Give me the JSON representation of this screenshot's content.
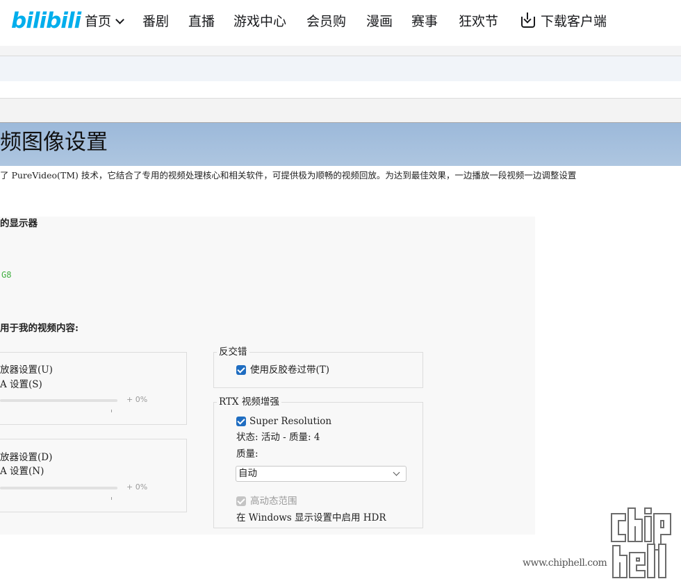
{
  "header": {
    "logo": "bilibili",
    "nav": [
      {
        "label": "首页"
      },
      {
        "label": "番剧"
      },
      {
        "label": "直播"
      },
      {
        "label": "游戏中心"
      },
      {
        "label": "会员购"
      },
      {
        "label": "漫画"
      },
      {
        "label": "赛事"
      },
      {
        "label": "狂欢节"
      },
      {
        "label": "下载客户端",
        "icon": "download-icon"
      }
    ]
  },
  "panel": {
    "title": "频图像设置",
    "description": "了 PureVideo(TM) 技术，它结合了专用的视频处理核心和相关软件，可提供极为顺畅的视频回放。为达到最佳效果，一边播放一段视频一边调整设置",
    "display_heading": "的显示器",
    "display_name": "G8",
    "content_heading": "用于我的视频内容:",
    "left_groups": [
      {
        "option1": "放器设置(U)",
        "option2": "A 设置(S)",
        "value": "+ 0%"
      },
      {
        "option1": "放器设置(D)",
        "option2": "A 设置(N)",
        "value": "+ 0%"
      }
    ],
    "deinterlace": {
      "title": "反交错",
      "checkbox_label": "使用反胶卷过带(T)",
      "checked": true
    },
    "rtx": {
      "title": "RTX 视频增强",
      "sr_label": "Super Resolution",
      "sr_checked": true,
      "status": "状态: 活动 - 质量: 4",
      "quality_label": "质量:",
      "quality_value": "自动",
      "hdr_label": "高动态范围",
      "hdr_checked": true,
      "hdr_disabled": true,
      "hdr_note": "在 Windows 显示设置中启用 HDR"
    }
  },
  "watermark": {
    "url": "www.chiphell.com",
    "logo": "chiphell"
  },
  "colors": {
    "bilibili_blue": "#00aeec",
    "title_bar": "#a5bfdd",
    "checkbox": "#1f6dc1",
    "display_name_green": "#3fae3f"
  }
}
